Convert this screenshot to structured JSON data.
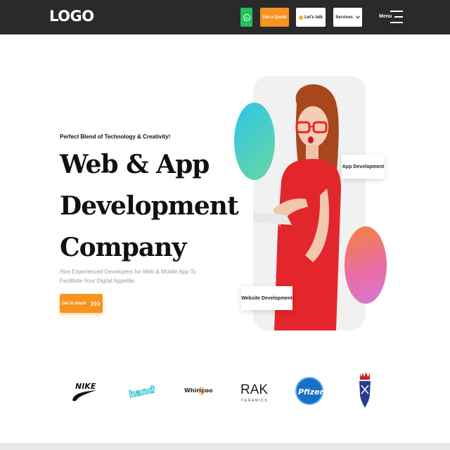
{
  "header": {
    "logo": "LOGO",
    "quote_label": "Get a Quote",
    "talk_label": "Let's talk",
    "services_label": "Services",
    "menu_label": "Menu"
  },
  "hero": {
    "tagline": "Perfect Blend of Technology & Creativity!",
    "headline": [
      "Web & App",
      "Development",
      "Company"
    ],
    "subtext": "Hire Experienced Developers for Web & Mobile App To Facilitate Your Digital Appetite.",
    "cta_label": "Get in touch",
    "badge_app": "App Development",
    "badge_web": "Website Development"
  },
  "brands": [
    {
      "name": "NIKE",
      "icon": "nike-logo"
    },
    {
      "name": "handy",
      "icon": "handy-logo"
    },
    {
      "name": "Whirlpool",
      "icon": "whirlpool-logo"
    },
    {
      "name": "RAK",
      "sub": "CERAMICS",
      "icon": "rak-ceramics-logo"
    },
    {
      "name": "Pfizer",
      "icon": "pfizer-logo"
    },
    {
      "name": "",
      "icon": "crest-logo"
    }
  ],
  "colors": {
    "header_bg": "#2a2a2a",
    "accent": "#f7931e",
    "whatsapp": "#25c05a"
  }
}
